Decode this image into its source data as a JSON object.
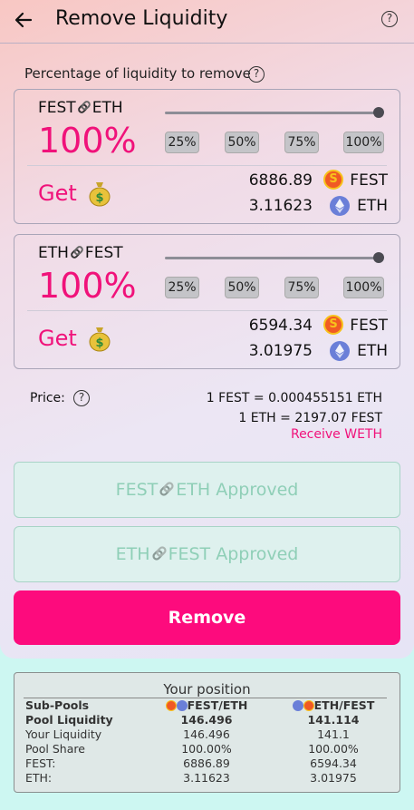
{
  "header": {
    "title": "Remove Liquidity"
  },
  "percentage_label": "Percentage of liquidity to remove",
  "pools": [
    {
      "pair_left": "FEST",
      "pair_right": "ETH",
      "percent": "100%",
      "slider_value": 1.0,
      "buttons": [
        "25%",
        "50%",
        "75%",
        "100%"
      ],
      "get_label": "Get",
      "amount1": "6886.89",
      "token1": "FEST",
      "amount2": "3.11623",
      "token2": "ETH"
    },
    {
      "pair_left": "ETH",
      "pair_right": "FEST",
      "percent": "100%",
      "slider_value": 1.0,
      "buttons": [
        "25%",
        "50%",
        "75%",
        "100%"
      ],
      "get_label": "Get",
      "amount1": "6594.34",
      "token1": "FEST",
      "amount2": "3.01975",
      "token2": "ETH"
    }
  ],
  "price": {
    "label": "Price:",
    "line1": "1 FEST = 0.000455151 ETH",
    "line2": "1 ETH = 2197.07 FEST",
    "receive_weth": "Receive WETH"
  },
  "approved_buttons": [
    {
      "left": "FEST",
      "right": "ETH Approved"
    },
    {
      "left": "ETH",
      "right": "FEST Approved"
    }
  ],
  "remove_label": "Remove",
  "position": {
    "title": "Your position",
    "header": {
      "c1": "Sub-Pools",
      "c2": "FEST/ETH",
      "c3": "ETH/FEST"
    },
    "rows": [
      {
        "c1": "Pool Liquidity",
        "c2": "146.496",
        "c3": "141.114"
      },
      {
        "c1": "Your Liquidity",
        "c2": "146.496",
        "c3": "141.1"
      },
      {
        "c1": "Pool Share",
        "c2": "100.00%",
        "c3": "100.00%"
      },
      {
        "c1": "FEST:",
        "c2": "6886.89",
        "c3": "6594.34"
      },
      {
        "c1": "ETH:",
        "c2": "3.11623",
        "c3": "3.01975"
      }
    ]
  },
  "colors": {
    "accent": "#fd0b7d",
    "approved_text": "#8fcfb7",
    "fest": "#f05a24",
    "eth": "#6a7fd8"
  }
}
